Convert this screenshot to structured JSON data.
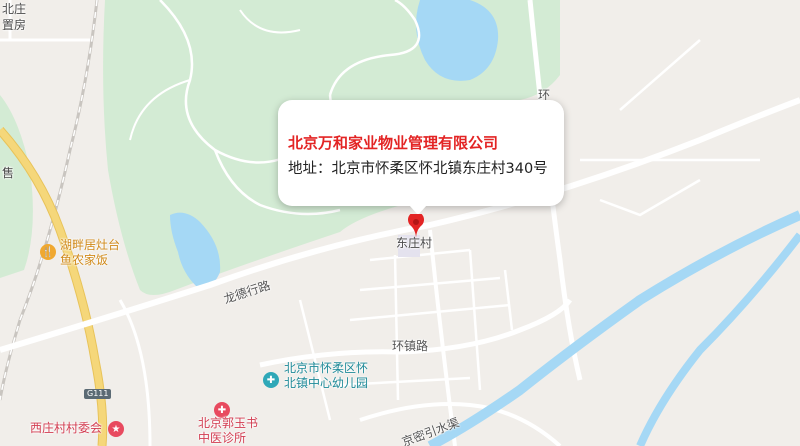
{
  "popup": {
    "title": "北京万和家业物业管理有限公司",
    "address": "地址：北京市怀柔区怀北镇东庄村340号"
  },
  "labels": {
    "north_village": "北庄",
    "north_village_sub": "置房",
    "ring_top": "环",
    "east_village": "东庄村",
    "longde_road": "龙德行路",
    "huanzhen_road": "环镇路",
    "canal": "京密引水渠",
    "left_partial": "售"
  },
  "pois": {
    "restaurant": {
      "line1": "湖畔居灶台",
      "line2": "鱼农家饭",
      "color": "#f0a830"
    },
    "kindergarten": {
      "line1": "北京市怀柔区怀",
      "line2": "北镇中心幼儿园",
      "color": "#2fa8b8"
    },
    "clinic": {
      "line1": "北京郭玉书",
      "line2": "中医诊所",
      "color": "#e84a5f"
    },
    "village_committee": {
      "line1": "西庄村村委会",
      "color": "#e84a5f"
    }
  },
  "highway_shield": "G111",
  "marker_icon": "location-pin-icon",
  "colors": {
    "land": "#f1eeea",
    "park": "#d3ebd4",
    "water": "#a5d8f5",
    "road": "#ffffff",
    "highway": "#f5d77a",
    "accent": "#e32424"
  }
}
